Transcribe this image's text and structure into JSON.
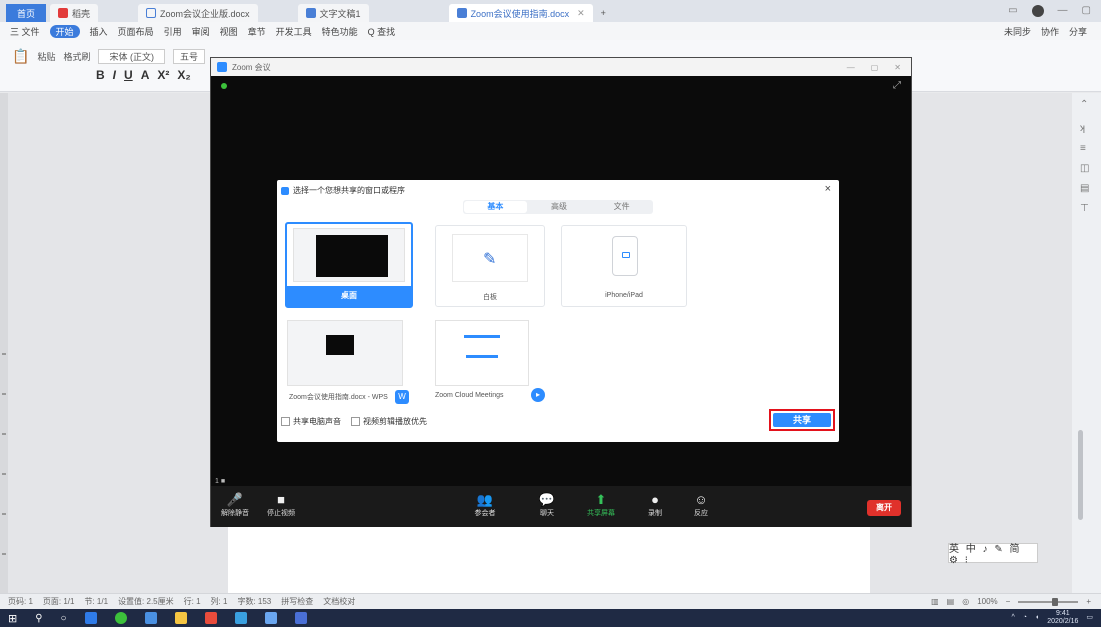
{
  "tabs": {
    "home": "首页",
    "t1": "稻壳",
    "t2": "Zoom会议企业版.docx",
    "t3": "文字文稿1",
    "t4": "Zoom会议使用指南.docx",
    "add": "+"
  },
  "menubar": {
    "items": [
      "三 文件",
      "开始",
      "插入",
      "页面布局",
      "引用",
      "审阅",
      "视图",
      "章节",
      "开发工具",
      "特色功能",
      "Q 查找"
    ],
    "active": "开始",
    "right": [
      "未同步",
      "协作",
      "分享"
    ]
  },
  "toolbar": {
    "row1": [
      "粘贴",
      "格式刷",
      "宋体 (正文)",
      "五号"
    ],
    "row2": [
      "B",
      "I",
      "U",
      "A",
      "X²",
      "X₂"
    ]
  },
  "zoom": {
    "title": "Zoom 会议",
    "dialog_title": "选择一个您想共享的窗口或程序",
    "tabs": [
      "基本",
      "高级",
      "文件"
    ],
    "cards": {
      "screen": "桌面",
      "whiteboard": "白板",
      "iphone": "iPhone/iPad",
      "doc": "Zoom会议使用指南.docx - WPS",
      "meetings": "Zoom Cloud Meetings"
    },
    "options": [
      "共享电脑声音",
      "视频剪辑播放优先"
    ],
    "share_button": "共享",
    "toolbar_hint": "1 ■",
    "controls": [
      {
        "label": "解除静音",
        "icon": "🎤"
      },
      {
        "label": "停止视频",
        "icon": "■"
      },
      {
        "label": "参会者",
        "icon": "👥"
      },
      {
        "label": "聊天",
        "icon": "💬"
      },
      {
        "label": "共享屏幕",
        "icon": "⬆"
      },
      {
        "label": "录制",
        "icon": "●"
      },
      {
        "label": "反应",
        "icon": "☺"
      }
    ],
    "leave": "离开"
  },
  "ime": "英 中 ♪ ✎ 简 ⚙ ⁝",
  "statusbar": {
    "left": [
      "页码: 1",
      "页面: 1/1",
      "节: 1/1",
      "设置值: 2.5厘米",
      "行: 1",
      "列: 1",
      "字数: 153",
      "拼写检查",
      "文档校对"
    ],
    "zoom": "100%"
  },
  "taskbar": {
    "time": "9:41",
    "date": "2020/2/16"
  },
  "colors": {
    "accent": "#2d8cff",
    "highlight": "#e3121c",
    "share_green": "#35c15a",
    "leave_red": "#e0312b"
  }
}
